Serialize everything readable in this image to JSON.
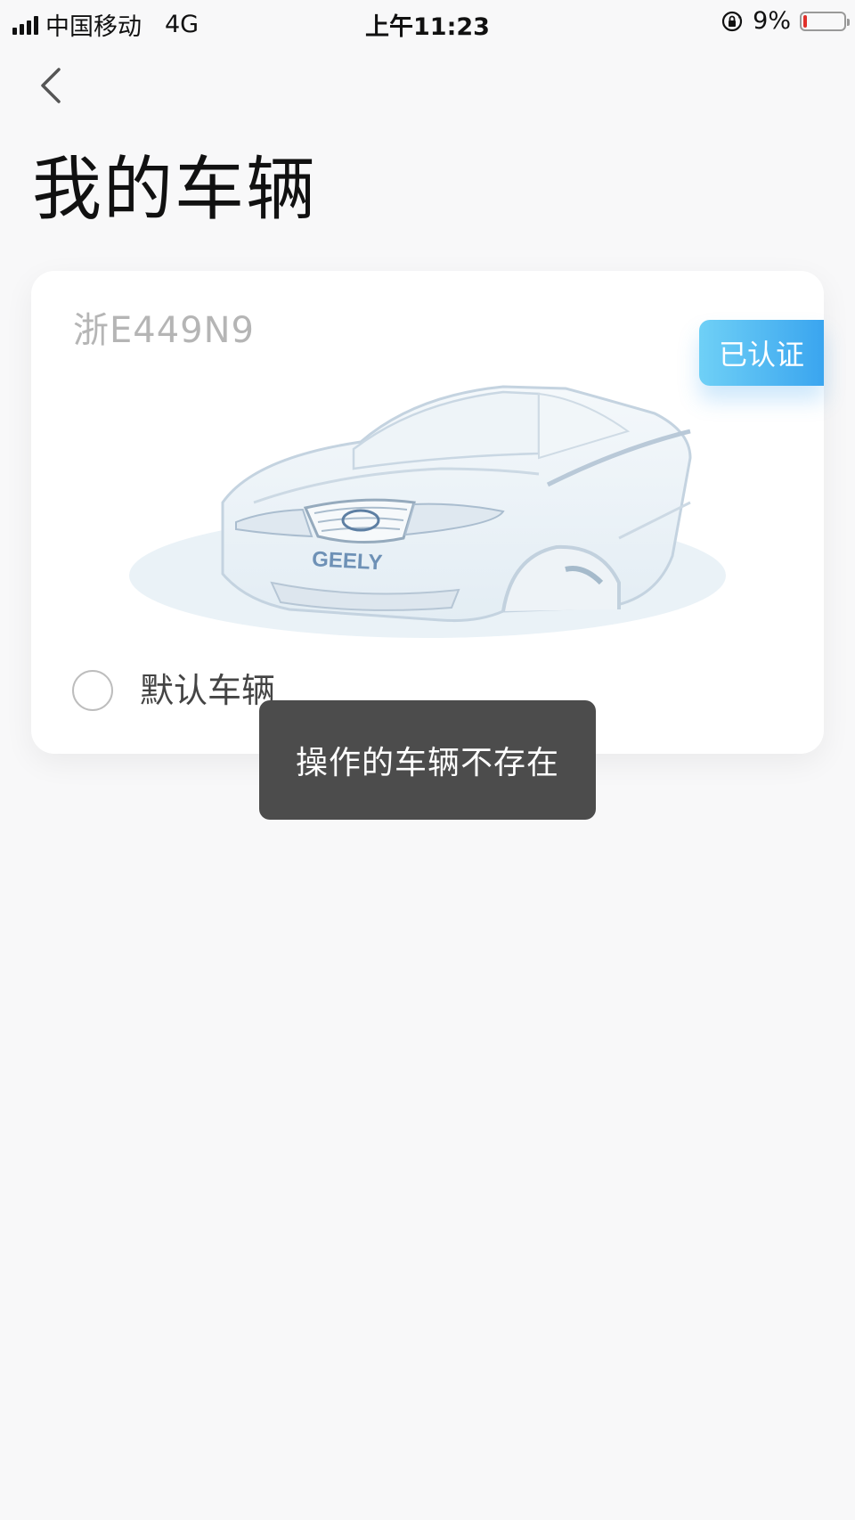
{
  "status_bar": {
    "carrier": "中国移动",
    "network": "4G",
    "time": "上午11:23",
    "battery": "9%",
    "battery_level": 0.09,
    "battery_color": "#e0302b"
  },
  "header": {
    "title": "我的车辆"
  },
  "vehicle_card": {
    "plate": "浙E449N9",
    "badge": "已认证",
    "brand_logo_text": "GEELY",
    "default_label": "默认车辆",
    "default_selected": false
  },
  "toast": {
    "message": "操作的车辆不存在"
  },
  "colors": {
    "background": "#f8f8f9",
    "badge_gradient_start": "#6fd0f6",
    "badge_gradient_end": "#3aa5ef",
    "toast_bg": "#4c4c4c"
  }
}
